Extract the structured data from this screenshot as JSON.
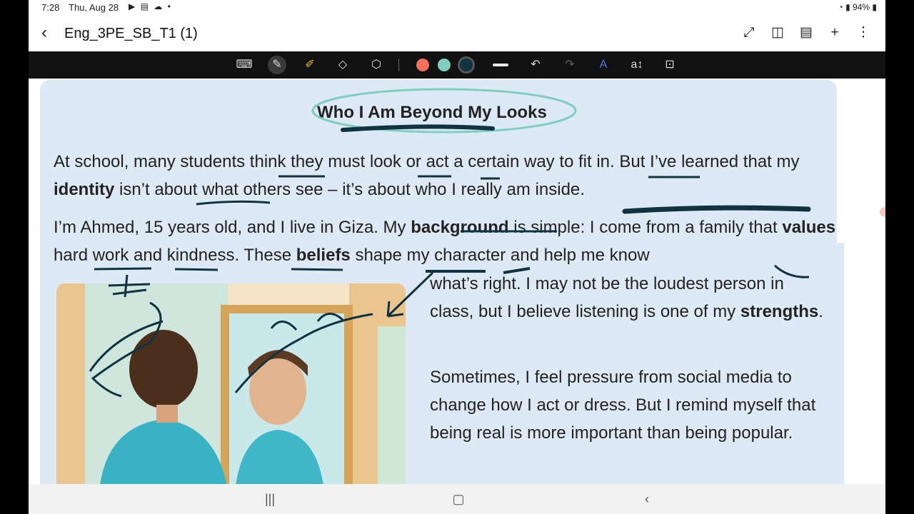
{
  "status_bar": {
    "time": "7:28",
    "date": "Thu, Aug 28",
    "battery": "94%"
  },
  "header": {
    "title": "Eng_3PE_SB_T1 (1)",
    "icons": [
      "back-arrow-icon",
      "expand-icon",
      "book-view-icon",
      "page-list-icon",
      "add-icon",
      "more-icon"
    ]
  },
  "toolbar": {
    "tools": [
      "keyboard-icon",
      "pen-icon",
      "highlighter-icon",
      "eraser-icon",
      "lasso-icon",
      "undo-icon",
      "redo-icon",
      "text-style-icon",
      "text-convert-icon",
      "lock-icon"
    ],
    "colors": [
      "#f2705c",
      "#7fcfc0",
      "#0f3340"
    ],
    "selected_color": "#0f3340"
  },
  "document": {
    "heading": "Who I Am Beyond My Looks",
    "p1": {
      "t1": "At school, many students think they must look or act a certain way to fit in. But I’ve learned that my ",
      "b1": "identity",
      "t2": " isn’t about what others see – it’s about who I really am inside."
    },
    "p2": {
      "t1": "I’m Ahmed, 15 years old, and I live in Giza. My ",
      "b1": "background",
      "t2": " is simple: I come from a family that ",
      "b2": "values",
      "t3": " hard work and kindness. These ",
      "b3": "beliefs",
      "t4": " shape my character and help me know"
    },
    "p3": {
      "t1": "what’s right. I may not be the loudest person in class, but I believe listening is one of my ",
      "b1": "strengths",
      "t2": "."
    },
    "p4": "Sometimes, I feel pressure from social media to change how I act or dress. But I remind myself that being real is more important than being popular."
  },
  "navbar": {
    "recent": "|||",
    "home": "▢",
    "back": "‹"
  }
}
